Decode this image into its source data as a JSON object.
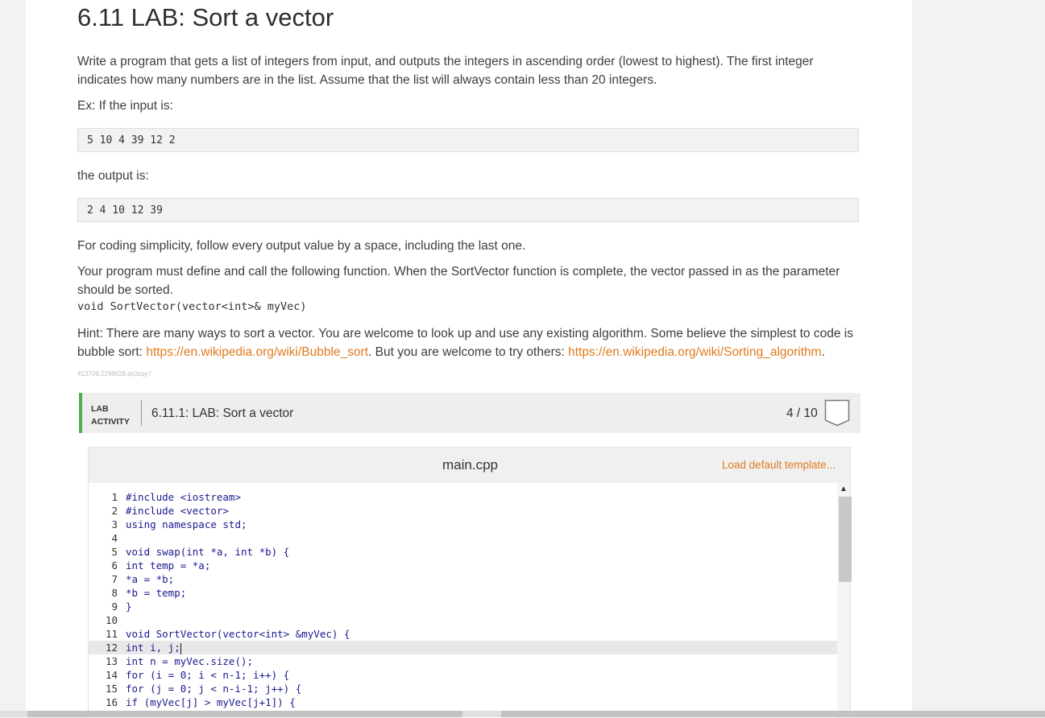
{
  "title": "6.11 LAB: Sort a vector",
  "intro": "Write a program that gets a list of integers from input, and outputs the integers in ascending order (lowest to highest). The first integer indicates how many numbers are in the list. Assume that the list will always contain less than 20 integers.",
  "example_label": "Ex: If the input is:",
  "example_input": "5 10 4 39 12 2",
  "output_label": "the output is:",
  "example_output": "2 4 10 12 39",
  "note_simplicity": "For coding simplicity, follow every output value by a space, including the last one.",
  "note_function": "Your program must define and call the following function. When the SortVector function is complete, the vector passed in as the parameter should be sorted.",
  "signature": "void SortVector(vector<int>& myVec)",
  "hint_prefix": "Hint: There are many ways to sort a vector. You are welcome to look up and use any existing algorithm. Some believe the simplest to code is bubble sort: ",
  "hint_link1": "https://en.wikipedia.org/wiki/Bubble_sort",
  "hint_middle": ". But you are welcome to try others: ",
  "hint_link2": "https://en.wikipedia.org/wiki/Sorting_algorithm",
  "hint_suffix": ".",
  "content_id": "413706.2298628.qx3zqy7",
  "lab": {
    "tag_line1": "LAB",
    "tag_line2": "ACTIVITY",
    "title": "6.11.1: LAB: Sort a vector",
    "score": "4 / 10",
    "file_name": "main.cpp",
    "load_template": "Load default template..."
  },
  "code_lines": [
    {
      "n": "1",
      "text": "#include <iostream>"
    },
    {
      "n": "2",
      "text": "#include <vector>"
    },
    {
      "n": "3",
      "text": "using namespace std;"
    },
    {
      "n": "4",
      "text": ""
    },
    {
      "n": "5",
      "text": "void swap(int *a, int *b) {"
    },
    {
      "n": "6",
      "text": "int temp = *a;"
    },
    {
      "n": "7",
      "text": "*a = *b;"
    },
    {
      "n": "8",
      "text": "*b = temp;"
    },
    {
      "n": "9",
      "text": "}"
    },
    {
      "n": "10",
      "text": ""
    },
    {
      "n": "11",
      "text": "void SortVector(vector<int> &myVec) {"
    },
    {
      "n": "12",
      "text": "int i, j;"
    },
    {
      "n": "13",
      "text": "int n = myVec.size();"
    },
    {
      "n": "14",
      "text": "for (i = 0; i < n-1; i++) {"
    },
    {
      "n": "15",
      "text": "for (j = 0; j < n-i-1; j++) {"
    },
    {
      "n": "16",
      "text": "if (myVec[j] > myVec[j+1]) {"
    }
  ],
  "active_line": 12
}
